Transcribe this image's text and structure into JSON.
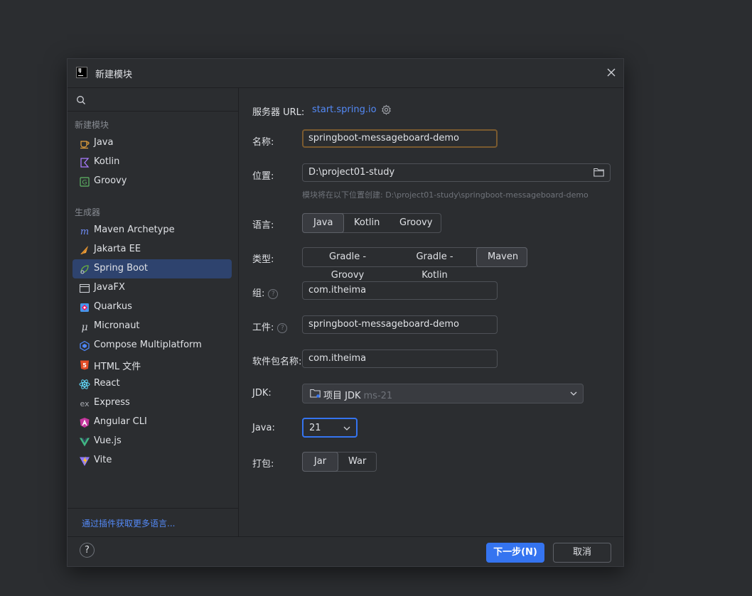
{
  "dialog": {
    "title": "新建模块"
  },
  "sidebar": {
    "section_new": "新建模块",
    "new_items": [
      {
        "label": "Java",
        "icon": "java-cup-icon"
      },
      {
        "label": "Kotlin",
        "icon": "kotlin-icon"
      },
      {
        "label": "Groovy",
        "icon": "groovy-icon"
      }
    ],
    "section_generators": "生成器",
    "generator_items": [
      {
        "label": "Maven Archetype",
        "icon": "maven-icon"
      },
      {
        "label": "Jakarta EE",
        "icon": "jakarta-ee-icon"
      },
      {
        "label": "Spring Boot",
        "icon": "spring-boot-icon",
        "selected": true
      },
      {
        "label": "JavaFX",
        "icon": "javafx-icon"
      },
      {
        "label": "Quarkus",
        "icon": "quarkus-icon"
      },
      {
        "label": "Micronaut",
        "icon": "micronaut-icon"
      },
      {
        "label": "Compose Multiplatform",
        "icon": "compose-icon"
      },
      {
        "label": "HTML 文件",
        "icon": "html5-icon"
      },
      {
        "label": "React",
        "icon": "react-icon"
      },
      {
        "label": "Express",
        "icon": "express-icon"
      },
      {
        "label": "Angular CLI",
        "icon": "angular-icon"
      },
      {
        "label": "Vue.js",
        "icon": "vue-icon"
      },
      {
        "label": "Vite",
        "icon": "vite-icon"
      }
    ],
    "more_link": "通过插件获取更多语言..."
  },
  "form": {
    "server_url_label": "服务器 URL:",
    "server_url": "start.spring.io",
    "name_label": "名称:",
    "name_value": "springboot-messageboard-demo",
    "location_label": "位置:",
    "location_value": "D:\\project01-study",
    "location_hint": "模块将在以下位置创建: D:\\project01-study\\springboot-messageboard-demo",
    "language_label": "语言:",
    "languages": [
      "Java",
      "Kotlin",
      "Groovy"
    ],
    "language_selected": "Java",
    "type_label": "类型:",
    "types": [
      "Gradle - Groovy",
      "Gradle - Kotlin",
      "Maven"
    ],
    "type_selected": "Maven",
    "group_label": "组:",
    "group_value": "com.itheima",
    "artifact_label": "工件:",
    "artifact_value": "springboot-messageboard-demo",
    "package_label": "软件包名称:",
    "package_value": "com.itheima",
    "jdk_label": "JDK:",
    "jdk_value": "项目 JDK",
    "jdk_sub": "ms-21",
    "java_label": "Java:",
    "java_value": "21",
    "packaging_label": "打包:",
    "packagings": [
      "Jar",
      "War"
    ],
    "packaging_selected": "Jar"
  },
  "footer": {
    "help": "?",
    "next_button": "下一步(N)",
    "cancel_button": "取消"
  },
  "colors": {
    "accent": "#3574f0",
    "link": "#548af7",
    "selected_bg": "#2e436e",
    "background": "#2b2d30"
  }
}
